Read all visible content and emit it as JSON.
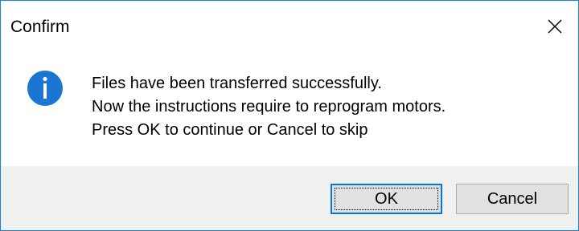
{
  "window": {
    "title": "Confirm",
    "close_glyph": "close-icon"
  },
  "message": {
    "icon": "info-icon",
    "icon_color": "#1b76d3",
    "lines": [
      "Files have been transferred successfully.",
      "Now the instructions require to reprogram motors.",
      "Press OK to continue or Cancel to skip"
    ]
  },
  "buttons": {
    "ok_label": "OK",
    "cancel_label": "Cancel"
  },
  "colors": {
    "window_border": "#1883d7",
    "footer_background": "#f0f0f0",
    "default_button_border": "#0078d7",
    "button_background": "#e1e1e1"
  }
}
